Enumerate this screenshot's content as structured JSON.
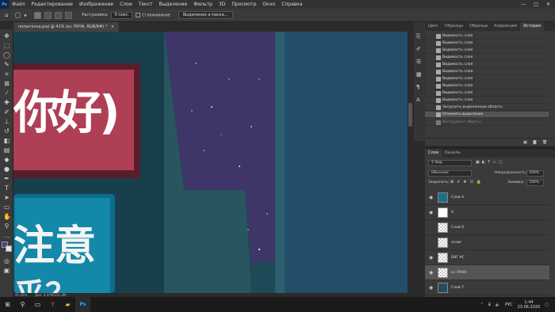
{
  "app": {
    "logo": "Ps"
  },
  "menu": [
    "Файл",
    "Редактирование",
    "Изображение",
    "Слои",
    "Текст",
    "Выделение",
    "Фильтр",
    "3D",
    "Просмотр",
    "Окно",
    "Справка"
  ],
  "window_controls": [
    "—",
    "□",
    "✕"
  ],
  "options": {
    "feather_label": "Растушевка:",
    "feather_value": "0 пикс.",
    "antialias_label": "Сглаживание",
    "select_mask_label": "Выделение и маска..."
  },
  "document": {
    "tab_title": "попыточка.psd @ 41% (кс ЛУНА, RGB/8#) *",
    "close": "×"
  },
  "status": {
    "zoom": "41,05%",
    "doc": "Док: 4,37M/311,4M"
  },
  "canvas": {
    "glyph_top": "你好)",
    "glyph_bottom": "注意",
    "glyph_bottom2": "乎？"
  },
  "history_panel": {
    "tabs": [
      "Цвет",
      "Образцы",
      "Образцы",
      "Коррекция",
      "История"
    ],
    "active_tab": "История",
    "items": [
      "Видимость слоя",
      "Видимость слоя",
      "Видимость слоя",
      "Видимость слоя",
      "Видимость слоя",
      "Видимость слоя",
      "Видимость слоя",
      "Видимость слоя",
      "Видимость слоя",
      "Видимость слоя",
      "Загрузить выделенную область",
      "Отменить выделение"
    ],
    "selected_index": 11,
    "footer_item": "Инструмент «Кисть»"
  },
  "layers_panel": {
    "tabs": [
      "Слои",
      "Каналы"
    ],
    "active_tab": "Слои",
    "kind_label": "Вид",
    "blend_mode": "Обычные",
    "opacity_label": "Непрозрачность:",
    "opacity_value": "100%",
    "lock_label": "Закрепить:",
    "fill_label": "Заливка:",
    "fill_value": "100%",
    "layers": [
      {
        "name": "Слой 4",
        "thumb": "img"
      },
      {
        "name": "А",
        "thumb": "img"
      },
      {
        "name": "Слой 6",
        "thumb": "checker"
      },
      {
        "name": "огомг",
        "thumb": "checker"
      },
      {
        "name": "БИГ КС",
        "thumb": "checker"
      },
      {
        "name": "кс ЛУНА",
        "thumb": "checker"
      },
      {
        "name": "Слой 7",
        "thumb": "img"
      }
    ],
    "selected_index": 5
  },
  "taskbar": {
    "lang": "РУС",
    "time": "1:44",
    "date": "23.06.2020"
  },
  "colors": {
    "accent": "#31a8ff",
    "canvas_teal": "#1f4f5c",
    "sky": "#3d3566"
  }
}
